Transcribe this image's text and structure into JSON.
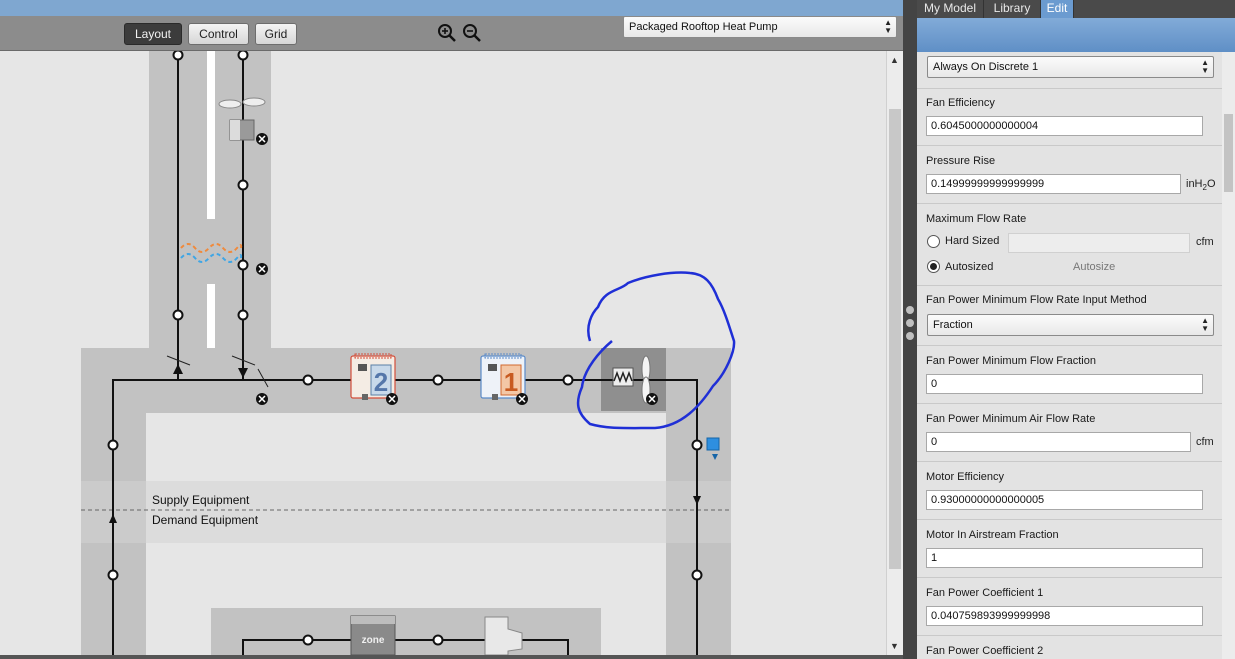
{
  "toolbar": {
    "layout_label": "Layout",
    "control_label": "Control",
    "grid_label": "Grid",
    "zoom_in_icon": "zoom-in-icon",
    "zoom_out_icon": "zoom-out-icon",
    "system_select": "Packaged Rooftop Heat Pump"
  },
  "diagram": {
    "supply_label": "Supply Equipment",
    "demand_label": "Demand Equipment",
    "coil2_number": "2",
    "coil1_number": "1",
    "zone_label": "zone"
  },
  "panel": {
    "tabs": [
      "My Model",
      "Library",
      "Edit"
    ],
    "active_tab": "Edit",
    "schedule_select": "Always On Discrete 1",
    "fields": {
      "fan_efficiency": {
        "label": "Fan Efficiency",
        "value": "0.6045000000000004"
      },
      "pressure_rise": {
        "label": "Pressure Rise",
        "value": "0.14999999999999999",
        "unit_base": "inH",
        "unit_sub": "2",
        "unit_tail": "O"
      },
      "max_flow": {
        "label": "Maximum Flow Rate",
        "hard_sized": "Hard Sized",
        "autosized": "Autosized",
        "autosize_placeholder": "Autosize",
        "unit": "cfm",
        "selected": "Autosized"
      },
      "min_flow_method": {
        "label": "Fan Power Minimum Flow Rate Input Method",
        "value": "Fraction"
      },
      "min_flow_fraction": {
        "label": "Fan Power Minimum Flow Fraction",
        "value": "0"
      },
      "min_air_flow": {
        "label": "Fan Power Minimum Air Flow Rate",
        "value": "0",
        "unit": "cfm"
      },
      "motor_efficiency": {
        "label": "Motor Efficiency",
        "value": "0.93000000000000005"
      },
      "motor_in_airstream": {
        "label": "Motor In Airstream Fraction",
        "value": "1"
      },
      "coef1": {
        "label": "Fan Power Coefficient 1",
        "value": "0.040759893999999998"
      },
      "coef2": {
        "label": "Fan Power Coefficient 2"
      }
    }
  },
  "colors": {
    "annotation_circle": "#1f2fd6",
    "loop_band": "#c2c2c2",
    "canvas_bg": "#e6e6e6",
    "selected_fan_bg": "#8f8f8f",
    "panel_header": "#6b9bd0"
  }
}
